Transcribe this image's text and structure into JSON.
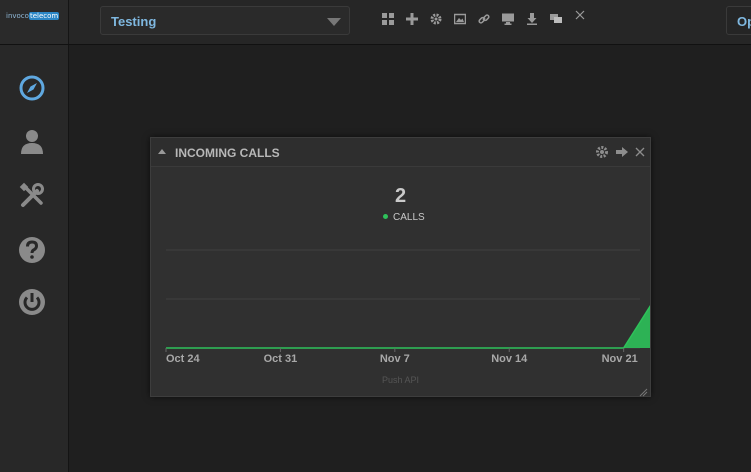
{
  "app": {
    "logo_left": "invoco",
    "logo_right": "telecom"
  },
  "toolbar": {
    "dashboard_selected": "Testing",
    "open_button_label": "Op",
    "tools": [
      "grid-icon",
      "add-icon",
      "settings-icon",
      "image-icon",
      "link-icon",
      "monitor-icon",
      "download-icon",
      "chat-icon",
      "close-icon"
    ]
  },
  "sidebar": {
    "items": [
      "compass-icon",
      "user-icon",
      "tools-icon",
      "help-icon",
      "power-icon"
    ],
    "active_color": "#5fa8e0",
    "icon_color": "#8a8a8a"
  },
  "widget": {
    "title": "INCOMING CALLS",
    "value": "2",
    "footer": "Push API"
  },
  "chart_data": {
    "type": "area",
    "series": [
      {
        "name": "CALLS",
        "color": "#2ec15a",
        "points": [
          [
            "Oct 24",
            0
          ],
          [
            "Oct 31",
            0
          ],
          [
            "Nov 7",
            0
          ],
          [
            "Nov 14",
            0
          ],
          [
            "Nov 21",
            0
          ],
          [
            "Nov 22",
            2
          ]
        ]
      }
    ],
    "x_ticks": [
      "Oct 24",
      "Oct 31",
      "Nov 7",
      "Nov 14",
      "Nov 21"
    ],
    "ylim": [
      0,
      2
    ],
    "grid": true
  }
}
